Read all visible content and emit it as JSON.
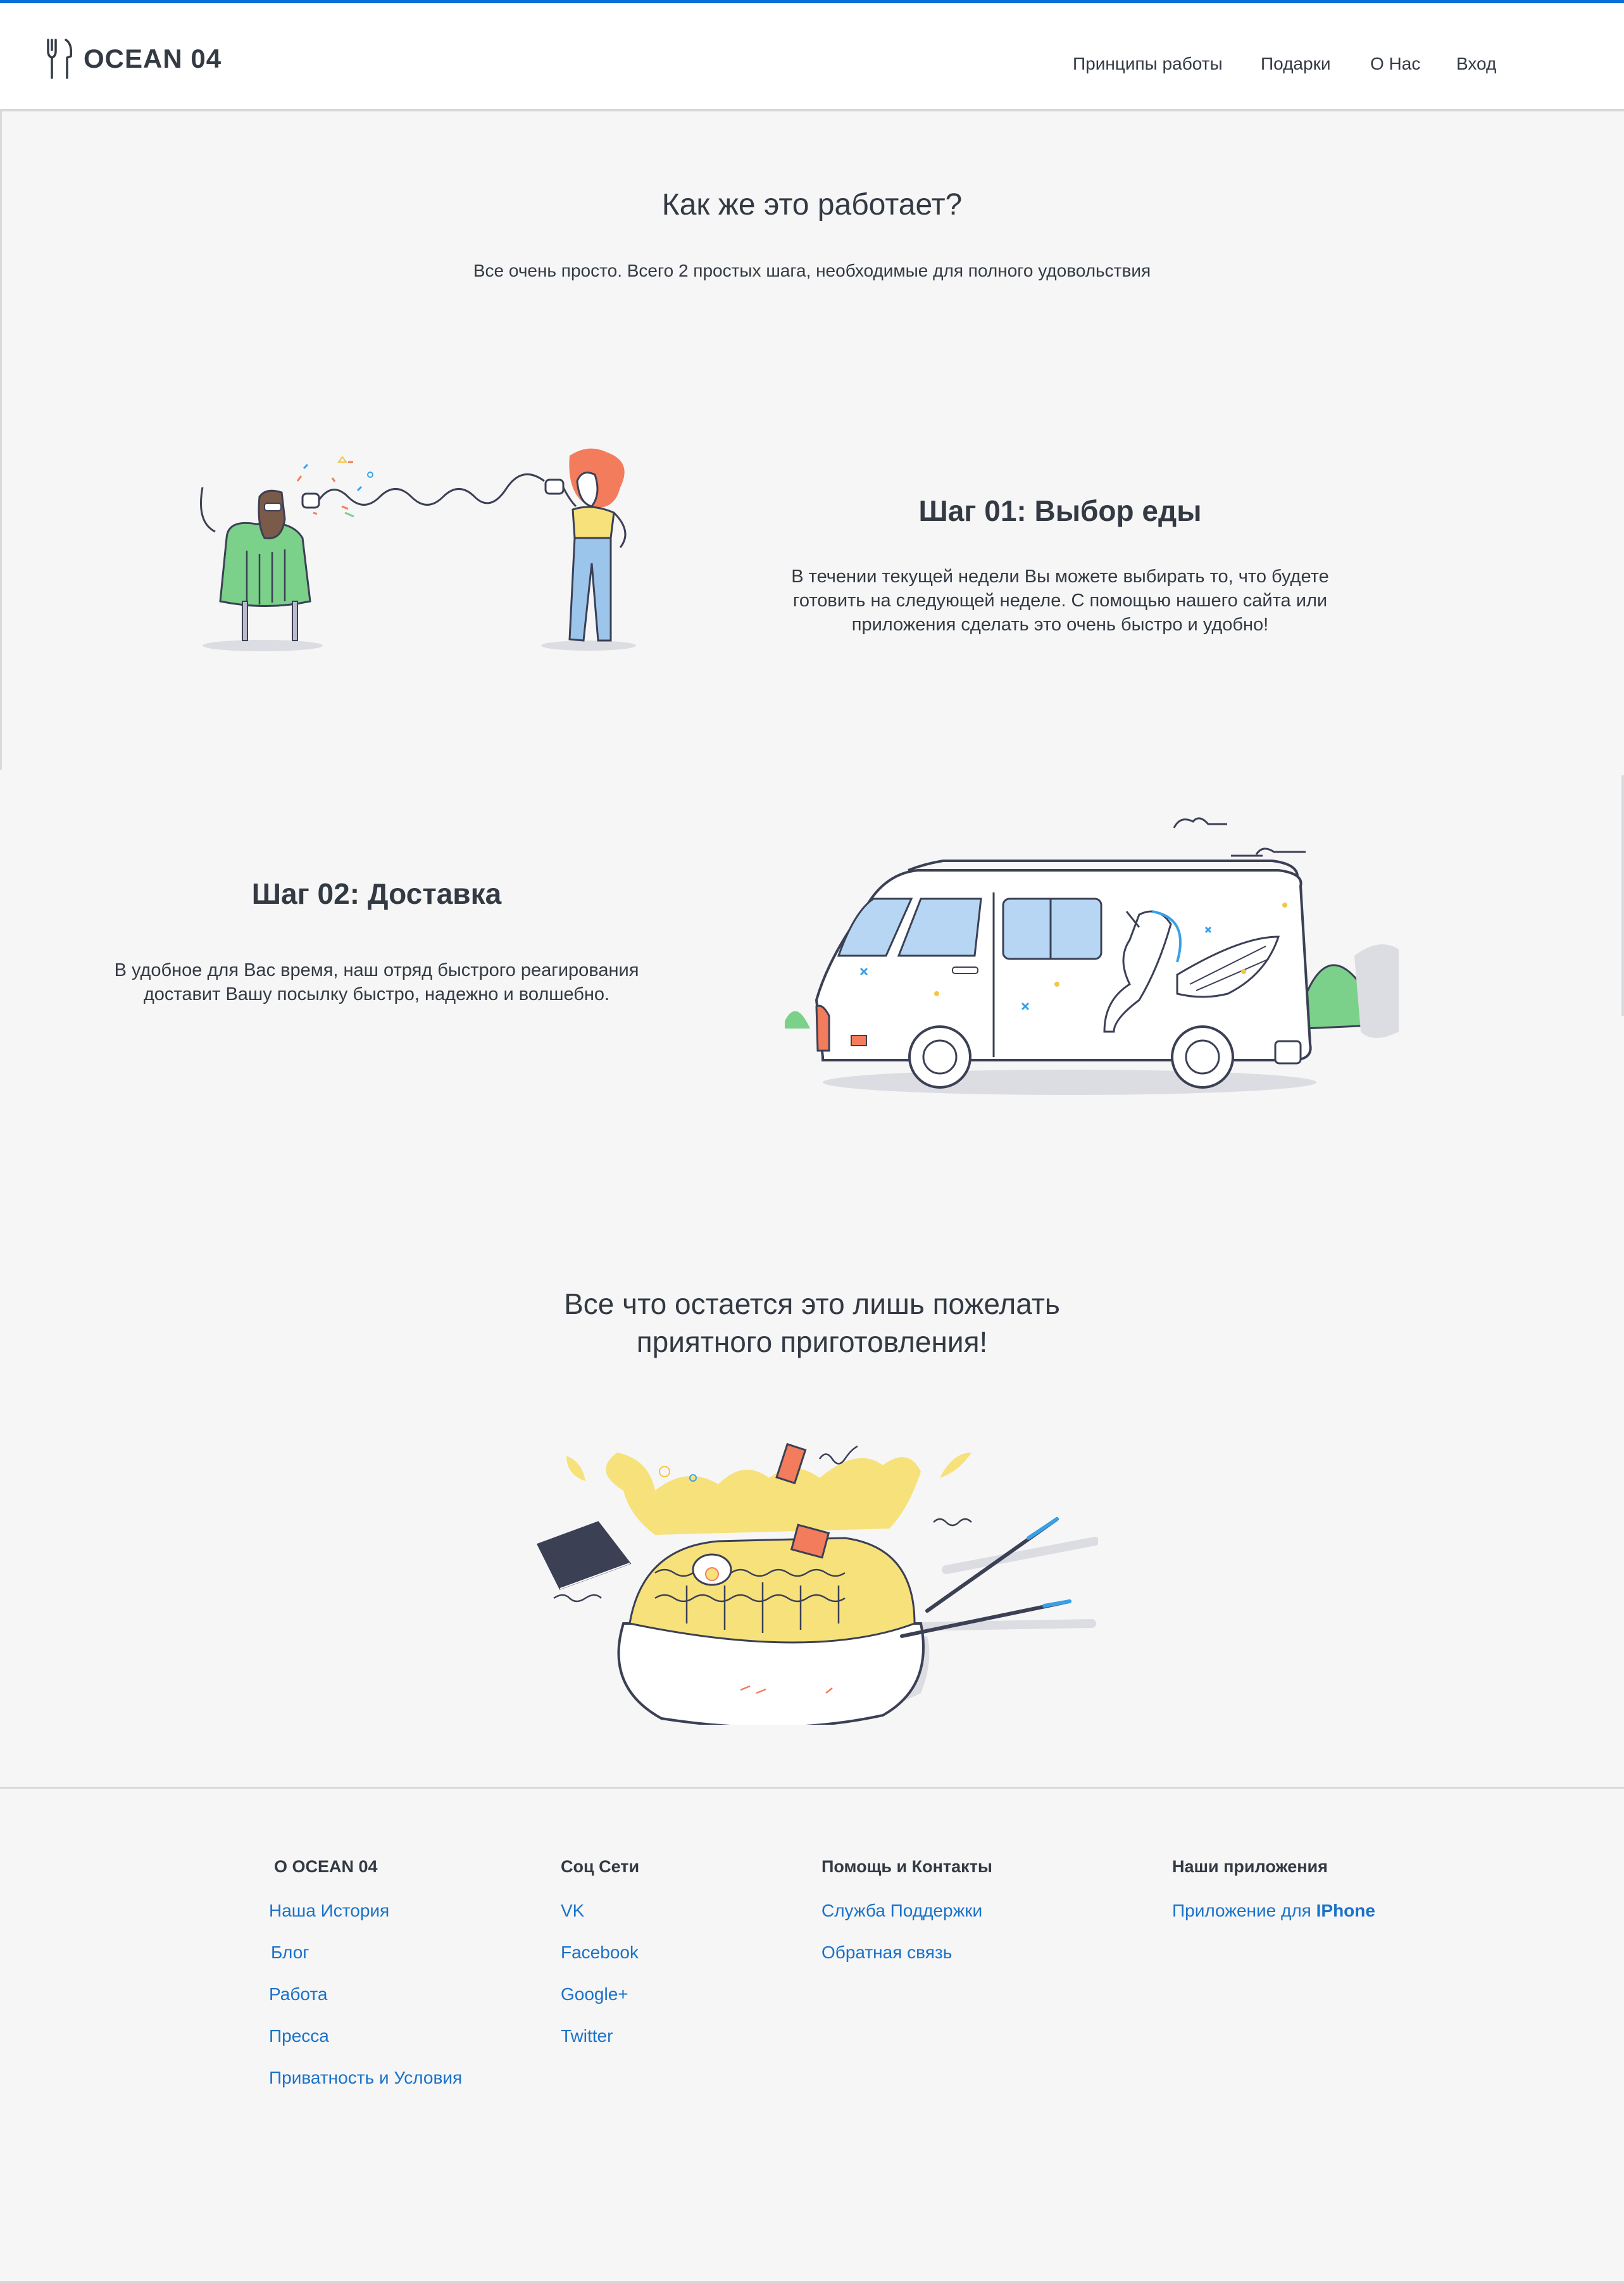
{
  "header": {
    "logo_text": "OCEAN 04",
    "nav": [
      "Принципы работы",
      "Подарки",
      "О Нас",
      "Вход"
    ]
  },
  "intro": {
    "title": "Как же это работает?",
    "subtitle": "Все очень просто. Всего 2 простых шага, необходимые для полного удовольствия"
  },
  "steps": [
    {
      "title": "Шаг 01: Выбор еды",
      "text": "В течении текущей недели Вы можете выбирать то, что будете готовить на следующей неделе. С помощью нашего сайта или приложения сделать это очень быстро и удобно!"
    },
    {
      "title": "Шаг 02:  Доставка",
      "text": "В удобное для Вас время, наш отряд быстрого реагирования доставит Вашу посылку быстро, надежно и волшебно."
    }
  ],
  "wish": {
    "line1": "Все что остается это лишь пожелать",
    "line2": "приятного приготовления!"
  },
  "footer": {
    "about": {
      "title": "О OCEAN 04",
      "links": [
        "Наша История",
        "Блог",
        "Работа",
        "Пресса",
        "Приватность и Условия"
      ]
    },
    "social": {
      "title": "Соц Сети",
      "links": [
        "VK",
        "Facebook",
        "Google+",
        "Twitter"
      ]
    },
    "help": {
      "title": "Помощь и Контакты",
      "links": [
        "Служба Поддержки",
        "Обратная связь"
      ]
    },
    "apps": {
      "title": "Наши приложения",
      "link_prefix": "Приложение для ",
      "link_bold": "IPhone"
    }
  },
  "icons": {
    "logo": "fork-knife-icon",
    "illustration_1": "tin-can-phone-people-illustration",
    "illustration_2": "unicorn-van-illustration",
    "illustration_3": "noodle-bowl-illustration"
  },
  "colors": {
    "accent": "#0a6fd6",
    "link": "#1a72c9",
    "text": "#333a44",
    "background": "#f6f6f6"
  }
}
